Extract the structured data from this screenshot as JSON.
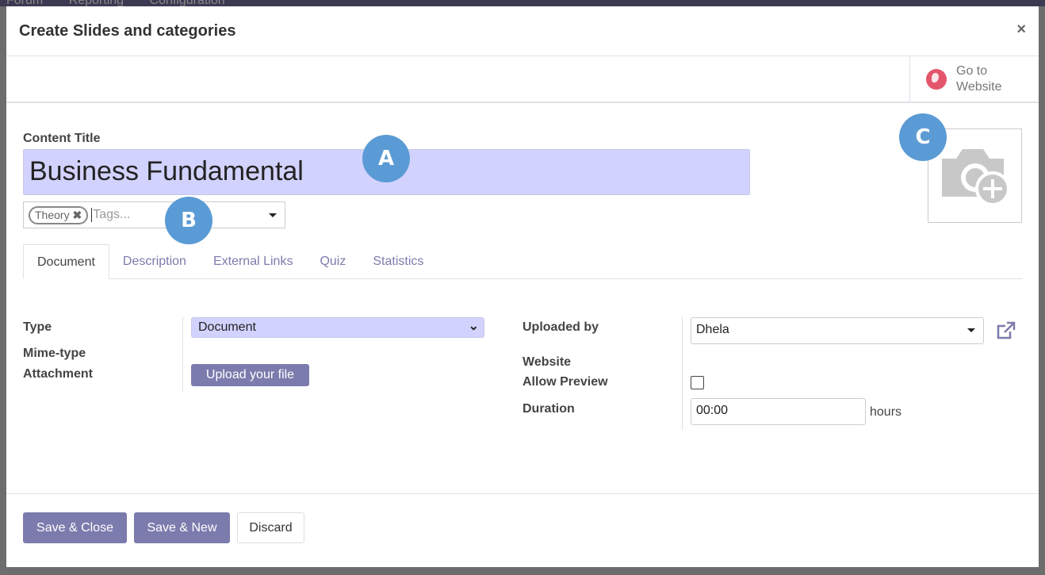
{
  "topnav": {
    "items": [
      "Forum",
      "Reporting",
      "Configuration"
    ]
  },
  "modal": {
    "title": "Create Slides and categories",
    "close": "×"
  },
  "button_box": {
    "go_to_website": "Go to Website"
  },
  "form": {
    "content_title_label": "Content Title",
    "content_title_value": "Business Fundamental",
    "tags": [
      "Theory"
    ],
    "tags_placeholder": "Tags...",
    "tabs": [
      {
        "label": "Document",
        "active": true
      },
      {
        "label": "Description"
      },
      {
        "label": "External Links"
      },
      {
        "label": "Quiz"
      },
      {
        "label": "Statistics"
      }
    ],
    "left": {
      "type_label": "Type",
      "type_value": "Document",
      "mime_label": "Mime-type",
      "attachment_label": "Attachment",
      "upload_label": "Upload your file"
    },
    "right": {
      "uploaded_by_label": "Uploaded by",
      "uploaded_by_value": "Dhela",
      "website_label": "Website",
      "allow_preview_label": "Allow Preview",
      "allow_preview": false,
      "duration_label": "Duration",
      "duration_value": "00:00",
      "duration_unit": "hours"
    }
  },
  "footer": {
    "save_close": "Save & Close",
    "save_new": "Save & New",
    "discard": "Discard"
  },
  "annotations": [
    "A",
    "B",
    "C"
  ],
  "colors": {
    "primary": "#7c7bad",
    "required_field": "#d2d2ff",
    "annotation": "#5b9bd5",
    "globe": "#e3566b"
  }
}
